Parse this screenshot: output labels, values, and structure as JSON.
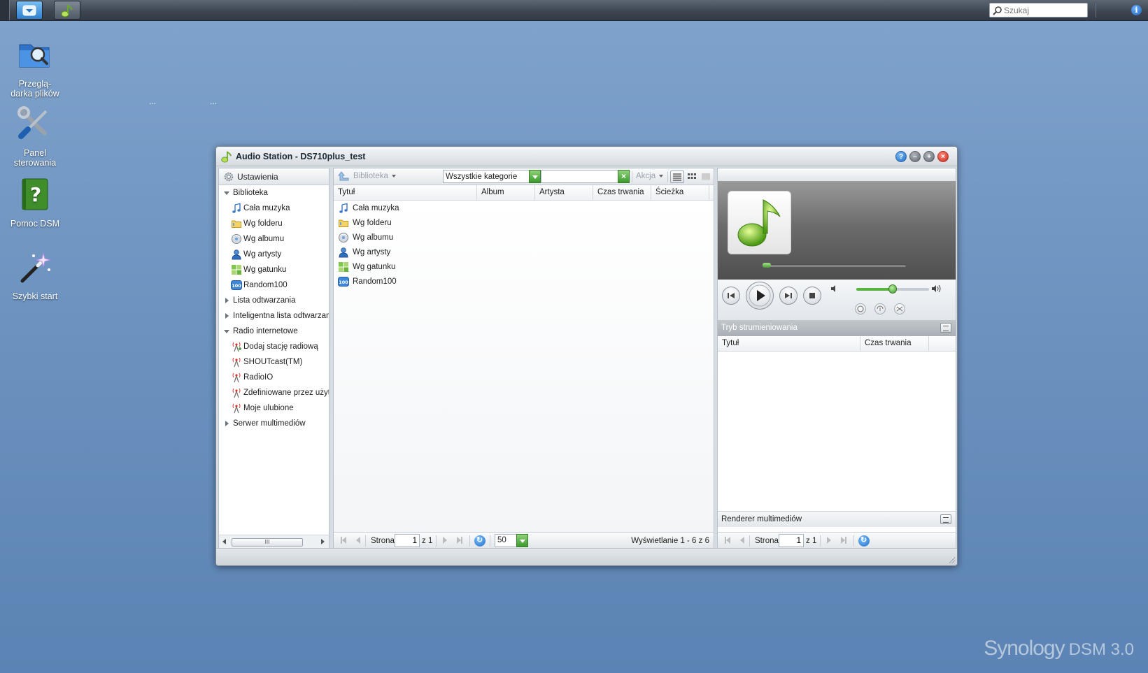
{
  "taskbar": {
    "search_placeholder": "Szukaj",
    "start_icon": "chevron-down-icon",
    "app_icon": "audio-station-icon",
    "info_icon": "info-icon",
    "info_label": "i"
  },
  "desktop": {
    "icons": [
      {
        "label": "Przeglą-\ndarka plików",
        "icon": "file-browser-icon"
      },
      {
        "label": "Panel\nsterowania",
        "icon": "control-panel-icon"
      },
      {
        "label": "Pomoc DSM",
        "icon": "help-book-icon"
      },
      {
        "label": "Szybki start",
        "icon": "magic-wand-icon"
      }
    ],
    "dots": [
      "...",
      "..."
    ],
    "watermark_brand": "Synology",
    "watermark_version": "DSM 3.0"
  },
  "window": {
    "title": "Audio Station - DS710plus_test",
    "controls": {
      "help": "?",
      "minimize": "–",
      "maximize": "+",
      "close": "×"
    },
    "tree": {
      "settings_label": "Ustawienia",
      "rows": [
        {
          "label": "Biblioteka",
          "type": "expanded",
          "icon": "triangle-down-icon"
        },
        {
          "label": "Cała muzyka",
          "type": "child",
          "icon": "music-note-icon"
        },
        {
          "label": "Wg folderu",
          "type": "child",
          "icon": "folder-icon"
        },
        {
          "label": "Wg albumu",
          "type": "child",
          "icon": "album-disc-icon"
        },
        {
          "label": "Wg artysty",
          "type": "child",
          "icon": "artist-person-icon"
        },
        {
          "label": "Wg gatunku",
          "type": "child",
          "icon": "genre-grid-icon"
        },
        {
          "label": "Random100",
          "type": "child",
          "icon": "random100-icon"
        },
        {
          "label": "Lista odtwarzania",
          "type": "collapsed",
          "icon": "triangle-right-icon"
        },
        {
          "label": "Inteligentna lista odtwarzania",
          "type": "collapsed",
          "icon": "triangle-right-icon"
        },
        {
          "label": "Radio internetowe",
          "type": "expanded",
          "icon": "triangle-down-icon"
        },
        {
          "label": "Dodaj stację radiową",
          "type": "child",
          "icon": "radio-add-icon"
        },
        {
          "label": "SHOUTcast(TM)",
          "type": "child",
          "icon": "radio-antenna-icon"
        },
        {
          "label": "RadioIO",
          "type": "child",
          "icon": "radio-antenna-icon"
        },
        {
          "label": "Zdefiniowane przez użytkownika",
          "type": "child",
          "icon": "radio-antenna-icon"
        },
        {
          "label": "Moje ulubione",
          "type": "child",
          "icon": "radio-antenna-icon"
        },
        {
          "label": "Serwer multimediów",
          "type": "collapsed",
          "icon": "triangle-right-icon"
        }
      ],
      "scroll_thumb_label": "III"
    },
    "toolbar": {
      "library_label": "Biblioteka",
      "category_value": "Wszystkie kategorie",
      "filter_value": "",
      "clear_label": "×",
      "action_label": "Akcja"
    },
    "grid": {
      "columns": [
        "Tytuł",
        "Album",
        "Artysta",
        "Czas trwania",
        "Ścieżka"
      ],
      "rows": [
        {
          "title": "Cała muzyka",
          "icon": "music-note-icon"
        },
        {
          "title": "Wg folderu",
          "icon": "folder-icon"
        },
        {
          "title": "Wg albumu",
          "icon": "album-disc-icon"
        },
        {
          "title": "Wg artysty",
          "icon": "artist-person-icon"
        },
        {
          "title": "Wg gatunku",
          "icon": "genre-grid-icon"
        },
        {
          "title": "Random100",
          "icon": "random100-icon"
        }
      ]
    },
    "pager": {
      "page_label": "Strona",
      "page_value": "1",
      "of_label": "z 1",
      "page_size": "50",
      "status": "Wyświetlanie 1 - 6 z 6"
    },
    "player": {
      "stream_mode_label": "Tryb strumieniowania",
      "playlist_columns": [
        "Tytuł",
        "Czas trwania"
      ],
      "renderer_label": "Renderer multimediów",
      "page_label": "Strona",
      "page_value": "1",
      "of_label": "z 1",
      "progress": 0.0,
      "volume": 0.5
    }
  },
  "colors": {
    "desktop_top": "#7fa3cc",
    "desktop_bottom": "#5b83b3",
    "accent_green": "#58b43e",
    "close_red": "#c9241a",
    "help_blue": "#1f6bc4"
  }
}
